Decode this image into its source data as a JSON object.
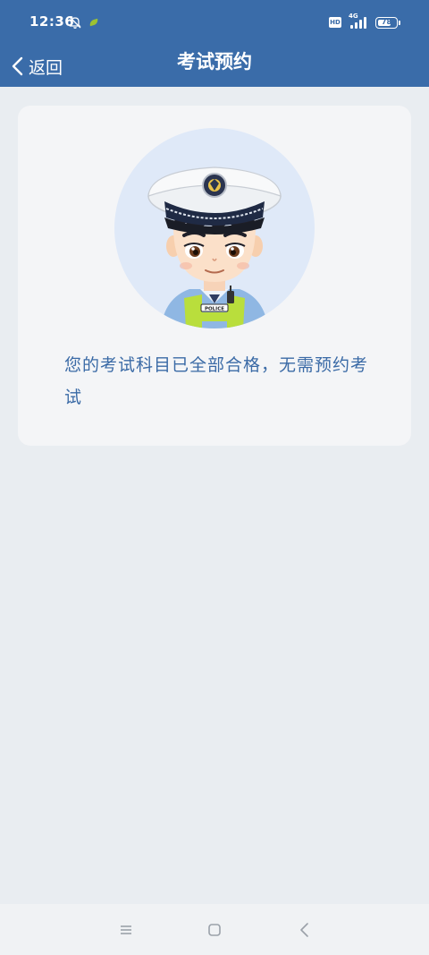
{
  "status_bar": {
    "time": "12:36",
    "hd_badge": "HD",
    "network": "4G",
    "battery_level": "78",
    "icons": [
      "bell-off-icon",
      "leaf-icon",
      "hd-icon",
      "signal-icon",
      "battery-icon"
    ]
  },
  "nav": {
    "back_label": "返回",
    "title": "考试预约"
  },
  "card": {
    "image": "police-cartoon-avatar",
    "badge_text": "POLICE",
    "message": "您的考试科目已全部合格，无需预约考试"
  },
  "system_nav": {
    "keys": [
      "menu-icon",
      "home-icon",
      "back-icon"
    ]
  },
  "colors": {
    "header_bg": "#3a6ca9",
    "page_bg": "#e9edf1",
    "card_bg": "#f4f5f7",
    "message_text": "#3a6aa6"
  }
}
